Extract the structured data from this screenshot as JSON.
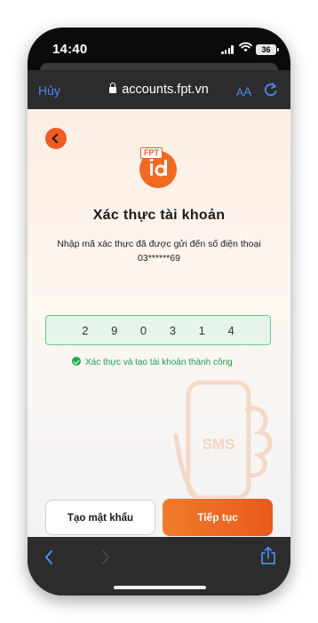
{
  "status_bar": {
    "time": "14:40",
    "battery": "36"
  },
  "browser": {
    "cancel_label": "Hủy",
    "url": "accounts.fpt.vn",
    "text_size_label_small": "A",
    "text_size_label_big": "A"
  },
  "page": {
    "logo_text": "FPT",
    "logo_sub": "id",
    "title": "Xác thực tài khoản",
    "description_line1": "Nhập mã xác thực đã được gửi đến số điện thoại",
    "description_line2": "03******69",
    "code_digits": [
      "2",
      "9",
      "0",
      "3",
      "1",
      "4"
    ],
    "success_message": "Xác thực và tạo tài khoản thành công",
    "illustration_text": "SMS",
    "secondary_button": "Tạo mật khẩu",
    "primary_button": "Tiếp tục"
  },
  "colors": {
    "brand_orange": "#f15a22",
    "success_green": "#22a651",
    "ios_blue": "#4c8cf0"
  },
  "icons": [
    "back-chevron-icon",
    "lock-icon",
    "reload-icon",
    "wifi-icon",
    "signal-icon",
    "battery-icon",
    "check-circle-icon",
    "share-icon"
  ]
}
